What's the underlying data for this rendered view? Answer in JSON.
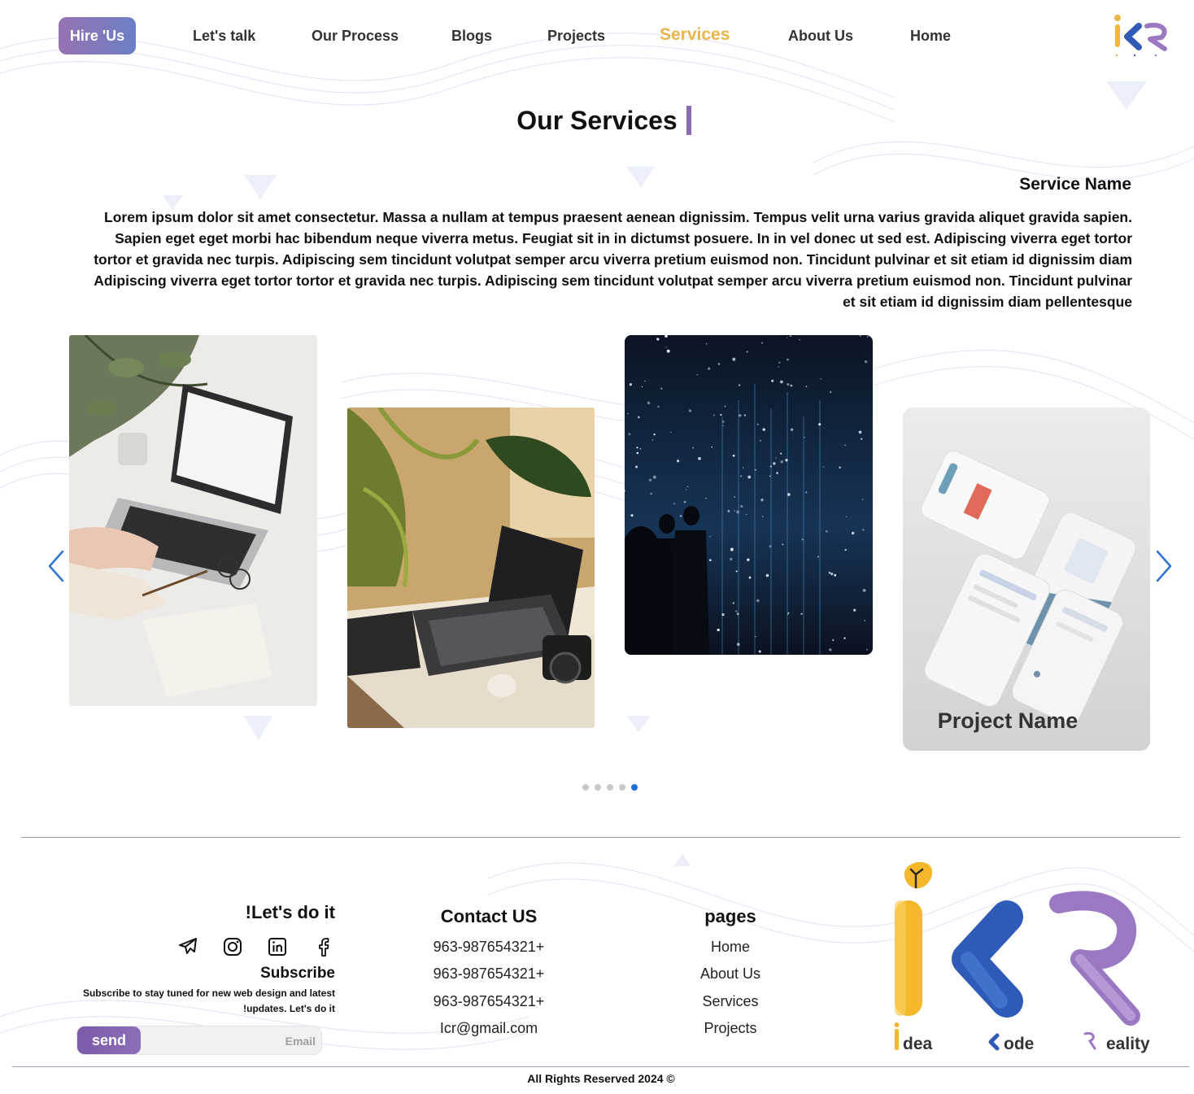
{
  "header": {
    "hire_label": "Hire 'Us",
    "nav": [
      "Let's talk",
      "Our Process",
      "Blogs",
      "Projects",
      "Services",
      "About Us",
      "Home"
    ],
    "active_nav": "Services",
    "logo_letters": "ICR"
  },
  "section": {
    "title": "Our Services",
    "service_name": "Service Name",
    "description": "Lorem ipsum dolor sit amet consectetur. Massa a nullam at tempus praesent aenean dignissim. Tempus velit urna varius gravida aliquet gravida sapien. Sapien eget eget morbi hac bibendum neque viverra metus. Feugiat sit in in dictumst posuere. In in vel donec ut sed est. Adipiscing viverra eget tortor tortor et gravida nec turpis. Adipiscing sem tincidunt volutpat semper arcu viverra pretium euismod non. Tincidunt pulvinar et sit etiam id dignissim diam Adipiscing viverra eget tortor tortor et gravida nec turpis. Adipiscing sem tincidunt volutpat semper arcu viverra pretium euismod non. Tincidunt pulvinar et sit etiam id dignissim diam pellentesque"
  },
  "slider": {
    "slides": [
      {
        "kind": "image",
        "subject": "laptop-on-white-desk"
      },
      {
        "kind": "image",
        "subject": "laptop-with-plants-and-camera"
      },
      {
        "kind": "image",
        "subject": "starry-light-installation"
      },
      {
        "kind": "project",
        "subject": "mobile-app-mockups",
        "caption": "Project Name"
      }
    ],
    "dots_total": 5,
    "active_dot": 5,
    "prev_icon": "chevron-left-icon",
    "next_icon": "chevron-right-icon"
  },
  "footer": {
    "social": {
      "heading": "!Let's do it",
      "icons": [
        "telegram-icon",
        "instagram-icon",
        "linkedin-icon",
        "facebook-icon"
      ]
    },
    "subscribe": {
      "title": "Subscribe",
      "text": "Subscribe to stay tuned for new web design and latest !updates. Let's do it",
      "send_label": "send",
      "email_placeholder": "Email"
    },
    "contact": {
      "heading": "Contact US",
      "lines": [
        "963-987654321+",
        "963-987654321+",
        "963-987654321+",
        "Icr@gmail.com"
      ]
    },
    "pages": {
      "heading": "pages",
      "links": [
        "Home",
        "About Us",
        "Services",
        "Projects"
      ]
    },
    "logo_words": {
      "i": "dea",
      "c": "ode",
      "r": "eality"
    },
    "copyright": "All Rights Reserved 2024 ©"
  },
  "colors": {
    "accent_gold": "#e9b64a",
    "accent_purple": "#8b6cb0",
    "accent_blue": "#2f5ab8",
    "dot_active": "#1e6fe0"
  }
}
